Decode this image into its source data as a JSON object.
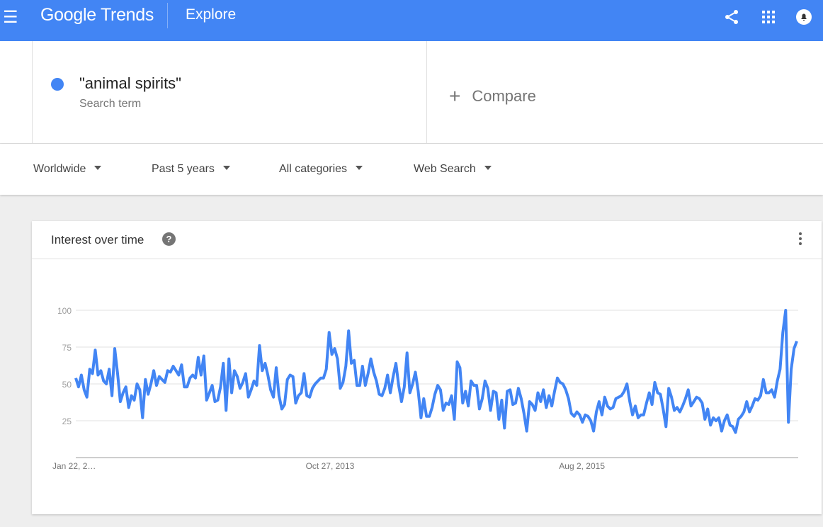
{
  "header": {
    "app_title": "Google Trends",
    "section": "Explore",
    "icons": [
      "menu-icon",
      "share-icon",
      "apps-grid-icon",
      "notifications-icon"
    ]
  },
  "search": {
    "term": "\"animal spirits\"",
    "term_type": "Search term",
    "term_color": "#4285f4",
    "compare_label": "Compare"
  },
  "filters": [
    {
      "label": "Worldwide"
    },
    {
      "label": "Past 5 years"
    },
    {
      "label": "All categories"
    },
    {
      "label": "Web Search"
    }
  ],
  "card": {
    "title": "Interest over time",
    "help_icon": "?"
  },
  "chart_data": {
    "type": "line",
    "title": "Interest over time",
    "ylim": [
      0,
      100
    ],
    "yticks": [
      25,
      50,
      75,
      100
    ],
    "grid": true,
    "color": "#4285f4",
    "x_start": "Jan 22, 2012",
    "x_interval": "weekly",
    "xtick_labels": [
      {
        "index": 0,
        "label": "Jan 22, 2…"
      },
      {
        "index": 92,
        "label": "Oct 27, 2013"
      },
      {
        "index": 183,
        "label": "Aug 2, 2015"
      }
    ],
    "series": [
      {
        "values": [
          54,
          48,
          56,
          46,
          41,
          60,
          57,
          73,
          56,
          59,
          52,
          50,
          60,
          42,
          74,
          57,
          38,
          44,
          48,
          34,
          42,
          39,
          50,
          46,
          27,
          53,
          43,
          50,
          59,
          49,
          55,
          53,
          51,
          59,
          58,
          62,
          59,
          56,
          63,
          48,
          48,
          54,
          56,
          54,
          68,
          56,
          69,
          39,
          44,
          49,
          38,
          39,
          48,
          64,
          32,
          67,
          44,
          59,
          55,
          47,
          51,
          57,
          41,
          46,
          52,
          49,
          76,
          59,
          64,
          56,
          46,
          41,
          61,
          42,
          33,
          36,
          53,
          56,
          55,
          37,
          42,
          44,
          57,
          42,
          41,
          47,
          50,
          52,
          54,
          54,
          60,
          85,
          70,
          74,
          67,
          47,
          51,
          62,
          86,
          64,
          66,
          49,
          49,
          62,
          49,
          57,
          67,
          58,
          52,
          43,
          42,
          47,
          56,
          44,
          55,
          64,
          49,
          38,
          48,
          71,
          44,
          50,
          58,
          45,
          27,
          40,
          28,
          28,
          34,
          43,
          49,
          46,
          32,
          37,
          36,
          42,
          26,
          65,
          61,
          37,
          45,
          35,
          52,
          49,
          49,
          33,
          40,
          52,
          47,
          32,
          45,
          44,
          26,
          39,
          20,
          45,
          46,
          36,
          37,
          47,
          40,
          30,
          18,
          38,
          36,
          32,
          44,
          38,
          46,
          34,
          42,
          35,
          45,
          54,
          51,
          50,
          46,
          40,
          30,
          28,
          31,
          29,
          24,
          29,
          28,
          25,
          18,
          31,
          38,
          29,
          41,
          35,
          33,
          34,
          40,
          41,
          42,
          45,
          50,
          38,
          29,
          35,
          27,
          29,
          29,
          37,
          44,
          36,
          51,
          44,
          43,
          33,
          21,
          47,
          41,
          32,
          34,
          31,
          35,
          40,
          46,
          35,
          38,
          41,
          40,
          37,
          26,
          33,
          22,
          27,
          25,
          27,
          18,
          25,
          29,
          22,
          21,
          17,
          26,
          28,
          31,
          38,
          31,
          35,
          40,
          39,
          42,
          53,
          44,
          44,
          46,
          41,
          52,
          60,
          85,
          100,
          24,
          60,
          74,
          79
        ]
      }
    ]
  }
}
